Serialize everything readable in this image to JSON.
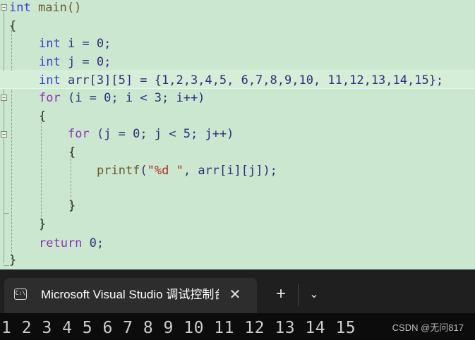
{
  "editor": {
    "lines": {
      "l1": {
        "kw": "int",
        "rest": " main()"
      },
      "l2": {
        "text": "{"
      },
      "l3": {
        "kw": "int",
        "rest": " i = 0;"
      },
      "l4": {
        "kw": "int",
        "rest": " j = 0;"
      },
      "l5": {
        "kw": "int",
        "rest": " arr[3][5] = {1,2,3,4,5, 6,7,8,9,10, 11,12,13,14,15};"
      },
      "l6": {
        "kw": "for",
        "rest": " (i = 0; i < 3; i++)"
      },
      "l7": {
        "text": "{"
      },
      "l8": {
        "kw": "for",
        "rest": " (j = 0; j < 5; j++)"
      },
      "l9": {
        "text": "{"
      },
      "l10": {
        "fn": "printf",
        "open": "(",
        "str": "\"%d \"",
        "rest": ", arr[i][j]);"
      },
      "l11": {
        "text": "}"
      },
      "l12": {
        "text": "}"
      },
      "l13": {
        "kw": "return",
        "rest": " 0;"
      },
      "l14": {
        "text": "}"
      }
    },
    "fold_symbol": "−"
  },
  "tabbar": {
    "tab_title": "Microsoft Visual Studio 调试控制台",
    "tab_icon_text": "C:\\",
    "close_glyph": "✕",
    "new_tab_glyph": "+",
    "dropdown_glyph": "⌄"
  },
  "console": {
    "output": "1 2 3 4 5 6 7 8 9 10 11 12 13 14 15",
    "watermark": "CSDN @无问817"
  },
  "colors": {
    "editor_bg": "#cbe7cf",
    "keyword": "#3a3fd4",
    "control_keyword": "#8a35b5",
    "string": "#b0282a",
    "tabbar_bg": "#1f1f1f",
    "console_bg": "#0c0c0c"
  }
}
